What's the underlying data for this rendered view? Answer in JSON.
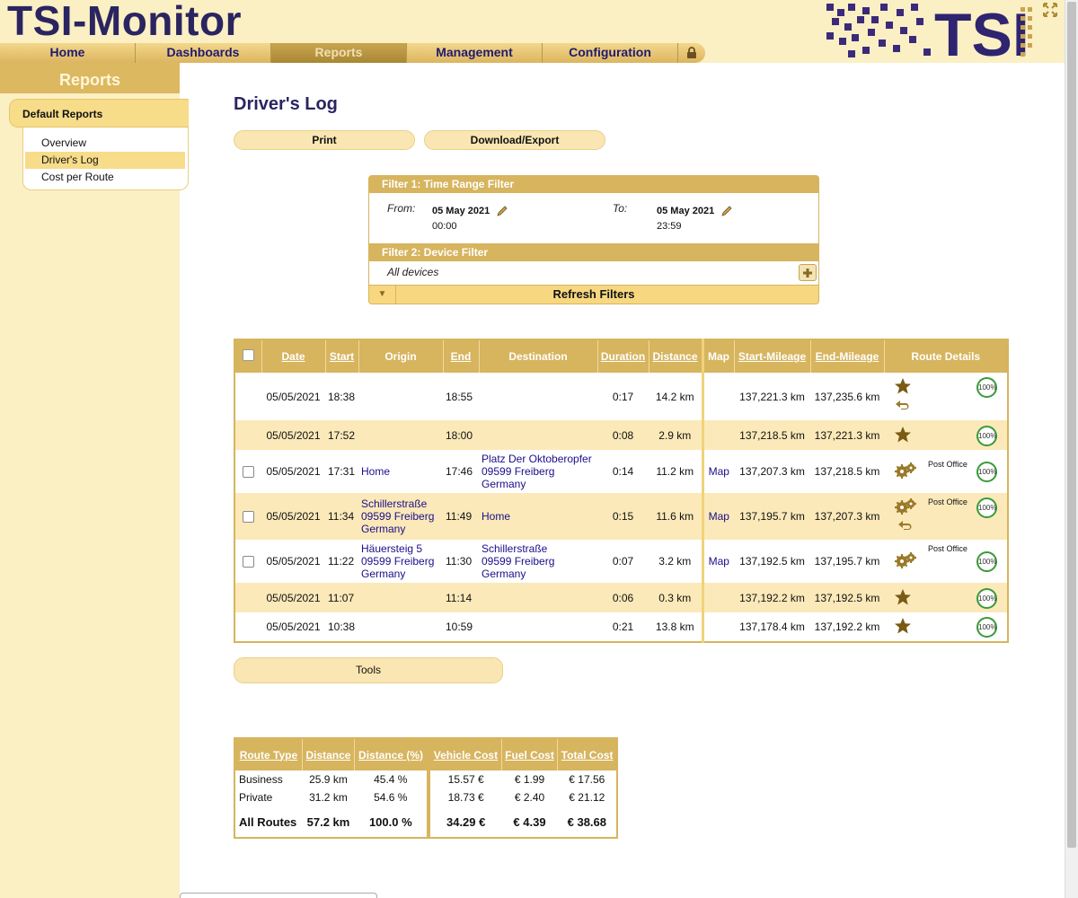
{
  "app": {
    "title": "TSI-Monitor",
    "logo_text": "TSI"
  },
  "nav": {
    "items": [
      {
        "label": "Home"
      },
      {
        "label": "Dashboards"
      },
      {
        "label": "Reports"
      },
      {
        "label": "Management"
      },
      {
        "label": "Configuration"
      }
    ]
  },
  "sidebar": {
    "title": "Reports",
    "section": "Default Reports",
    "links": [
      {
        "label": "Overview"
      },
      {
        "label": "Driver's Log"
      },
      {
        "label": "Cost per Route"
      }
    ]
  },
  "page": {
    "title": "Driver's Log",
    "print_label": "Print",
    "export_label": "Download/Export",
    "tools_label": "Tools"
  },
  "filters": {
    "time_header": "Filter 1: Time Range Filter",
    "from_label": "From:",
    "from_date": "05 May 2021",
    "from_time": "00:00",
    "to_label": "To:",
    "to_date": "05 May 2021",
    "to_time": "23:59",
    "device_header": "Filter 2: Device Filter",
    "device_value": "All devices",
    "refresh_label": "Refresh Filters"
  },
  "log_table": {
    "headers": {
      "date": "Date",
      "start": "Start",
      "origin": "Origin",
      "end": "End",
      "destination": "Destination",
      "duration": "Duration",
      "distance": "Distance",
      "map": "Map",
      "start_mileage": "Start-Mileage",
      "end_mileage": "End-Mileage",
      "route_details": "Route Details"
    },
    "rows": [
      {
        "date": "05/05/2021",
        "start": "18:38",
        "origin": [],
        "end": "18:55",
        "destination": [],
        "duration": "0:17",
        "distance": "14.2 km",
        "map": "",
        "start_mileage": "137,221.3 km",
        "end_mileage": "137,235.6 km",
        "checkbox": false,
        "star": true,
        "gear": false,
        "undo": true,
        "post": "",
        "pct": "100%"
      },
      {
        "date": "05/05/2021",
        "start": "17:52",
        "origin": [],
        "end": "18:00",
        "destination": [],
        "duration": "0:08",
        "distance": "2.9 km",
        "map": "",
        "start_mileage": "137,218.5 km",
        "end_mileage": "137,221.3 km",
        "checkbox": false,
        "star": true,
        "gear": false,
        "undo": false,
        "post": "",
        "pct": "100%"
      },
      {
        "date": "05/05/2021",
        "start": "17:31",
        "origin": [
          "Home"
        ],
        "end": "17:46",
        "destination": [
          "Platz Der Oktoberopfer",
          "09599 Freiberg",
          "Germany"
        ],
        "duration": "0:14",
        "distance": "11.2 km",
        "map": "Map",
        "start_mileage": "137,207.3 km",
        "end_mileage": "137,218.5 km",
        "checkbox": true,
        "star": false,
        "gear": true,
        "undo": false,
        "post": "Post Office",
        "pct": "100%"
      },
      {
        "date": "05/05/2021",
        "start": "11:34",
        "origin": [
          "Schillerstraße",
          "09599 Freiberg",
          "Germany"
        ],
        "end": "11:49",
        "destination": [
          "Home"
        ],
        "duration": "0:15",
        "distance": "11.6 km",
        "map": "Map",
        "start_mileage": "137,195.7 km",
        "end_mileage": "137,207.3 km",
        "checkbox": true,
        "star": false,
        "gear": true,
        "undo": true,
        "post": "Post Office",
        "pct": "100%"
      },
      {
        "date": "05/05/2021",
        "start": "11:22",
        "origin": [
          "Häuersteig 5",
          "09599 Freiberg",
          "Germany"
        ],
        "end": "11:30",
        "destination": [
          "Schillerstraße",
          "09599 Freiberg",
          "Germany"
        ],
        "duration": "0:07",
        "distance": "3.2 km",
        "map": "Map",
        "start_mileage": "137,192.5 km",
        "end_mileage": "137,195.7 km",
        "checkbox": true,
        "star": false,
        "gear": true,
        "undo": false,
        "post": "Post Office",
        "pct": "100%"
      },
      {
        "date": "05/05/2021",
        "start": "11:07",
        "origin": [],
        "end": "11:14",
        "destination": [],
        "duration": "0:06",
        "distance": "0.3 km",
        "map": "",
        "start_mileage": "137,192.2 km",
        "end_mileage": "137,192.5 km",
        "checkbox": false,
        "star": true,
        "gear": false,
        "undo": false,
        "post": "",
        "pct": "100%"
      },
      {
        "date": "05/05/2021",
        "start": "10:38",
        "origin": [],
        "end": "10:59",
        "destination": [],
        "duration": "0:21",
        "distance": "13.8 km",
        "map": "",
        "start_mileage": "137,178.4 km",
        "end_mileage": "137,192.2 km",
        "checkbox": false,
        "star": true,
        "gear": false,
        "undo": false,
        "post": "",
        "pct": "100%"
      }
    ]
  },
  "summary": {
    "headers": {
      "route_type": "Route Type",
      "distance": "Distance",
      "distance_pct": "Distance (%)",
      "vehicle_cost": "Vehicle Cost",
      "fuel_cost": "Fuel Cost",
      "total_cost": "Total Cost"
    },
    "rows": [
      {
        "route_type": "Business",
        "distance": "25.9 km",
        "distance_pct": "45.4 %",
        "vehicle_cost": "15.57 €",
        "fuel_cost": "€ 1.99",
        "total_cost": "€ 17.56"
      },
      {
        "route_type": "Private",
        "distance": "31.2 km",
        "distance_pct": "54.6 %",
        "vehicle_cost": "18.73 €",
        "fuel_cost": "€ 2.40",
        "total_cost": "€ 21.12"
      }
    ],
    "total": {
      "route_type": "All Routes",
      "distance": "57.2 km",
      "distance_pct": "100.0 %",
      "vehicle_cost": "34.29 €",
      "fuel_cost": "€ 4.39",
      "total_cost": "€ 38.68"
    }
  },
  "colors": {
    "brand_navy": "#2a2560",
    "gold": "#d7b45e",
    "cream": "#fbefc4",
    "row_alt": "#fbe9b9",
    "link": "#1a0e8a",
    "progress_green": "#3a9a3a"
  },
  "icons": {
    "star": "star-icon",
    "gear": "gears-icon",
    "undo": "return-arrow-icon",
    "pencil": "pencil-icon",
    "lock": "lock-icon",
    "plus": "plus-icon",
    "collapse": "triangle-down-icon",
    "percent": "percent-circle-icon"
  }
}
